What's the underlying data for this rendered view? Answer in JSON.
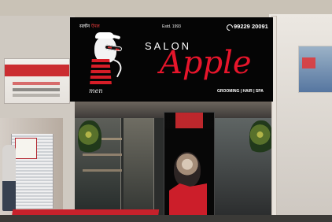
{
  "scene": {
    "description_label": "",
    "colors": {
      "sign_background": "#050505",
      "brand_red": "#e7152b",
      "white": "#ffffff"
    }
  },
  "sign": {
    "subbrand_prefix": "सलॉन",
    "subbrand_suffix": "ऍपल",
    "established": "Estd. 1993",
    "phone": "99229 20091",
    "brand_word": "SALON",
    "brand_name": "Apple",
    "services": "GROOMING | HAIR | SPA",
    "tagline": "men"
  },
  "icons": {
    "phone": "phone-icon",
    "mascot": "mascot-icon"
  }
}
